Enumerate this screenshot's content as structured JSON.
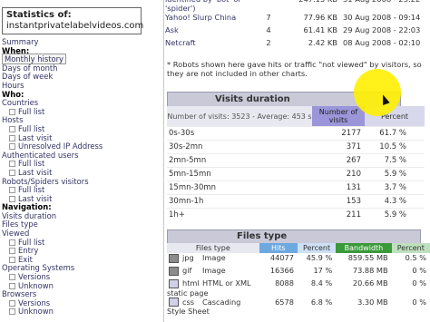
{
  "sidebar": {
    "stats_title": "Statistics of:",
    "stats_domain": "instantprivatelabelvideos.com",
    "items": [
      {
        "label": "Summary",
        "kind": "link"
      },
      {
        "label": "When:",
        "kind": "sec"
      },
      {
        "label": "Monthly history",
        "kind": "sel"
      },
      {
        "label": "Days of month",
        "kind": "link"
      },
      {
        "label": "Days of week",
        "kind": "link"
      },
      {
        "label": "Hours",
        "kind": "link"
      },
      {
        "label": "Who:",
        "kind": "sec"
      },
      {
        "label": "Countries",
        "kind": "link"
      },
      {
        "label": "Full list",
        "kind": "sub"
      },
      {
        "label": "Hosts",
        "kind": "link"
      },
      {
        "label": "Full list",
        "kind": "sub"
      },
      {
        "label": "Last visit",
        "kind": "sub"
      },
      {
        "label": "Unresolved IP Address",
        "kind": "sub"
      },
      {
        "label": "Authenticated users",
        "kind": "link"
      },
      {
        "label": "Full list",
        "kind": "sub"
      },
      {
        "label": "Last visit",
        "kind": "sub"
      },
      {
        "label": "Robots/Spiders visitors",
        "kind": "link"
      },
      {
        "label": "Full list",
        "kind": "sub"
      },
      {
        "label": "Last visit",
        "kind": "sub"
      },
      {
        "label": "Navigation:",
        "kind": "sec"
      },
      {
        "label": "Visits duration",
        "kind": "link"
      },
      {
        "label": "Files type",
        "kind": "link"
      },
      {
        "label": "Viewed",
        "kind": "link"
      },
      {
        "label": "Full list",
        "kind": "sub"
      },
      {
        "label": "Entry",
        "kind": "sub"
      },
      {
        "label": "Exit",
        "kind": "sub"
      },
      {
        "label": "Operating Systems",
        "kind": "link"
      },
      {
        "label": "Versions",
        "kind": "sub"
      },
      {
        "label": "Unknown",
        "kind": "sub"
      },
      {
        "label": "Browsers",
        "kind": "link"
      },
      {
        "label": "Versions",
        "kind": "sub"
      },
      {
        "label": "Unknown",
        "kind": "sub"
      }
    ]
  },
  "robots": {
    "rows": [
      {
        "name": "identified by 'bot' or 'spider')",
        "hits": "",
        "bandwidth": "",
        "date": ""
      },
      {
        "name": "Yahoo! Slurp China",
        "hits": "7",
        "bandwidth": "77.96 KB",
        "date": "30 Aug 2008 - 09:14"
      },
      {
        "name": "Ask",
        "hits": "4",
        "bandwidth": "61.41 KB",
        "date": "29 Aug 2008 - 22:03"
      },
      {
        "name": "Netcraft",
        "hits": "2",
        "bandwidth": "2.42 KB",
        "date": "08 Aug 2008 - 02:10"
      }
    ],
    "top_fragment": {
      "hits": "",
      "bandwidth": "247.15 KB",
      "date": "31 Aug 2008 - 23:22"
    },
    "note": "* Robots shown here gave hits or traffic \"not viewed\" by visitors, so they are not included in other charts."
  },
  "visits_duration": {
    "title": "Visits duration",
    "header_label": "Number of visits: 3523 - Average: 453 s",
    "col_visits": "Number of visits",
    "col_percent": "Percent",
    "rows": [
      {
        "range": "0s-30s",
        "visits": "2177",
        "percent": "61.7 %"
      },
      {
        "range": "30s-2mn",
        "visits": "371",
        "percent": "10.5 %"
      },
      {
        "range": "2mn-5mn",
        "visits": "267",
        "percent": "7.5 %"
      },
      {
        "range": "5mn-15mn",
        "visits": "210",
        "percent": "5.9 %"
      },
      {
        "range": "15mn-30mn",
        "visits": "131",
        "percent": "3.7 %"
      },
      {
        "range": "30mn-1h",
        "visits": "153",
        "percent": "4.3 %"
      },
      {
        "range": "1h+",
        "visits": "211",
        "percent": "5.9 %"
      }
    ]
  },
  "files_type": {
    "title": "Files type",
    "cols": {
      "type": "Files type",
      "hits": "Hits",
      "percent": "Percent",
      "bandwidth": "Bandwidth",
      "bw_percent": "Percent"
    },
    "rows": [
      {
        "ext": "jpg",
        "desc": "Image",
        "hits": "44077",
        "percent": "45.9 %",
        "bandwidth": "859.55 MB",
        "bw_percent": "0.5 %"
      },
      {
        "ext": "gif",
        "desc": "Image",
        "hits": "16366",
        "percent": "17 %",
        "bandwidth": "73.88 MB",
        "bw_percent": "0 %"
      },
      {
        "ext": "html",
        "desc": "HTML or XML static page",
        "hits": "8088",
        "percent": "8.4 %",
        "bandwidth": "20.66 MB",
        "bw_percent": "0 %"
      },
      {
        "ext": "css",
        "desc": "Cascading Style Sheet",
        "hits": "6578",
        "percent": "6.8 %",
        "bandwidth": "3.30 MB",
        "bw_percent": "0 %"
      }
    ]
  }
}
